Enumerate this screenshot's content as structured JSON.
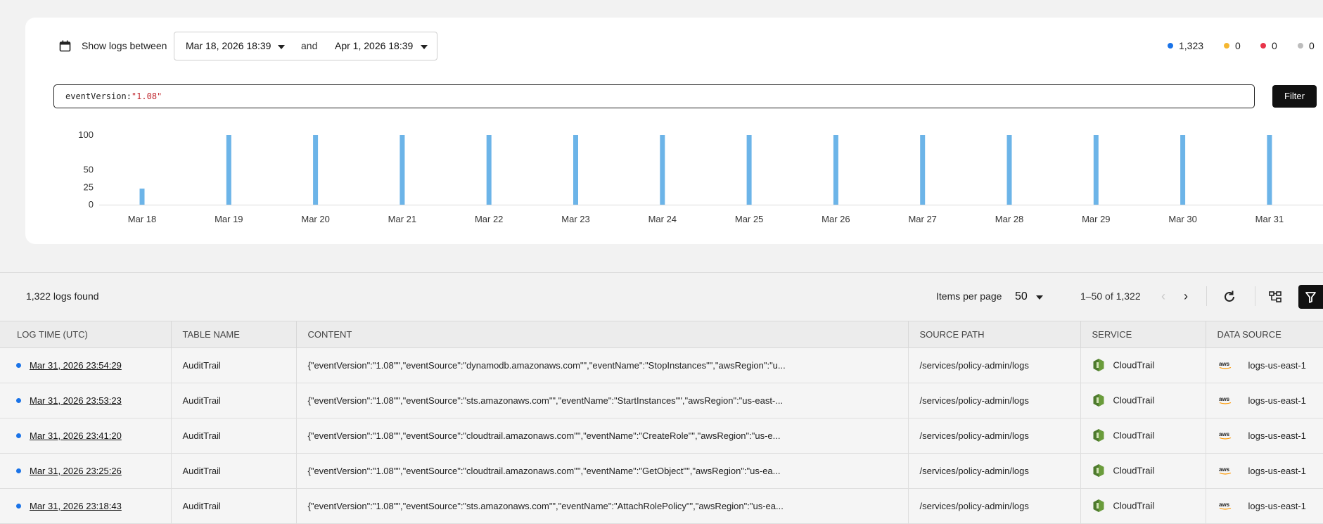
{
  "header": {
    "show_label": "Show logs between",
    "from_date": "Mar 18, 2026 18:39",
    "and_label": "and",
    "to_date": "Apr 1, 2026 18:39"
  },
  "legend": [
    {
      "count": "1,323",
      "color": "#1a73e8"
    },
    {
      "count": "0",
      "color": "#f5b731"
    },
    {
      "count": "0",
      "color": "#e8344a"
    },
    {
      "count": "0",
      "color": "#bdbdbd"
    }
  ],
  "query": {
    "key": "eventVersion:",
    "value": "\"1.08\""
  },
  "filter_label": "Filter",
  "chart_data": {
    "type": "bar",
    "categories": [
      "Mar 18",
      "Mar 19",
      "Mar 20",
      "Mar 21",
      "Mar 22",
      "Mar 23",
      "Mar 24",
      "Mar 25",
      "Mar 26",
      "Mar 27",
      "Mar 28",
      "Mar 29",
      "Mar 30",
      "Mar 31"
    ],
    "values": [
      23,
      100,
      100,
      100,
      100,
      100,
      100,
      100,
      100,
      100,
      100,
      100,
      100,
      100
    ],
    "yticks": [
      "100",
      "50",
      "25",
      "0"
    ],
    "ylim": [
      0,
      100
    ],
    "color": "#6cb4e8",
    "grid": false
  },
  "toolbar": {
    "logs_found": "1,322 logs found",
    "items_per_page_label": "Items per page",
    "items_per_page_value": "50",
    "pagination": "1–50 of 1,322"
  },
  "table": {
    "columns": [
      "LOG TIME (UTC)",
      "TABLE NAME",
      "CONTENT",
      "SOURCE PATH",
      "SERVICE",
      "DATA SOURCE"
    ],
    "rows": [
      {
        "time": "Mar 31, 2026 23:54:29",
        "table": "AuditTrail",
        "content": "{\"eventVersion\":\"1.08\"\",\"eventSource\":\"dynamodb.amazonaws.com\"\",\"eventName\":\"StopInstances\"\",\"awsRegion\":\"u...",
        "path": "/services/policy-admin/logs",
        "service": "CloudTrail",
        "source": "logs-us-east-1"
      },
      {
        "time": "Mar 31, 2026 23:53:23",
        "table": "AuditTrail",
        "content": "{\"eventVersion\":\"1.08\"\",\"eventSource\":\"sts.amazonaws.com\"\",\"eventName\":\"StartInstances\"\",\"awsRegion\":\"us-east-...",
        "path": "/services/policy-admin/logs",
        "service": "CloudTrail",
        "source": "logs-us-east-1"
      },
      {
        "time": "Mar 31, 2026 23:41:20",
        "table": "AuditTrail",
        "content": "{\"eventVersion\":\"1.08\"\",\"eventSource\":\"cloudtrail.amazonaws.com\"\",\"eventName\":\"CreateRole\"\",\"awsRegion\":\"us-e...",
        "path": "/services/policy-admin/logs",
        "service": "CloudTrail",
        "source": "logs-us-east-1"
      },
      {
        "time": "Mar 31, 2026 23:25:26",
        "table": "AuditTrail",
        "content": "{\"eventVersion\":\"1.08\"\",\"eventSource\":\"cloudtrail.amazonaws.com\"\",\"eventName\":\"GetObject\"\",\"awsRegion\":\"us-ea...",
        "path": "/services/policy-admin/logs",
        "service": "CloudTrail",
        "source": "logs-us-east-1"
      },
      {
        "time": "Mar 31, 2026 23:18:43",
        "table": "AuditTrail",
        "content": "{\"eventVersion\":\"1.08\"\",\"eventSource\":\"sts.amazonaws.com\"\",\"eventName\":\"AttachRolePolicy\"\",\"awsRegion\":\"us-ea...",
        "path": "/services/policy-admin/logs",
        "service": "CloudTrail",
        "source": "logs-us-east-1"
      }
    ]
  }
}
